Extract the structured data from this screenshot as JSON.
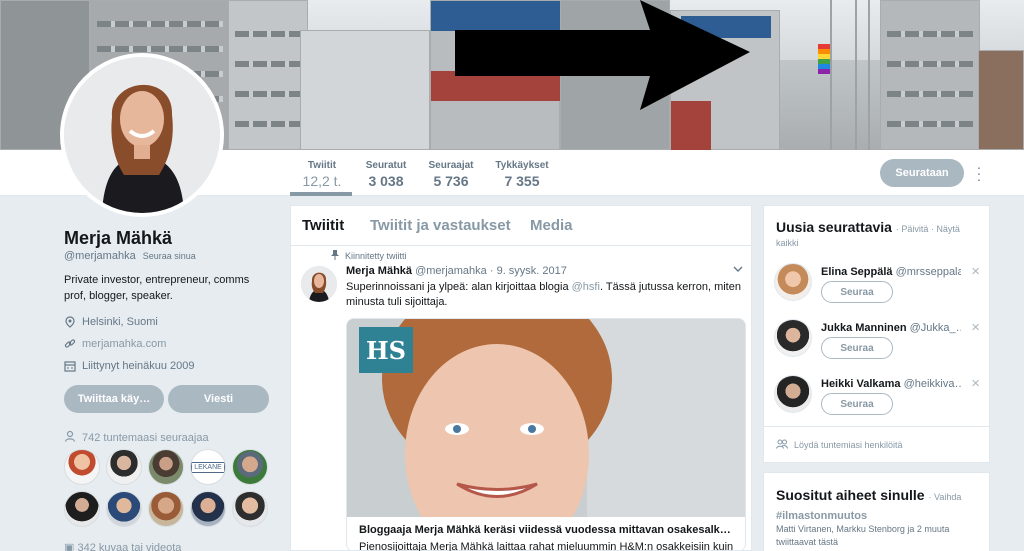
{
  "profile": {
    "name": "Merja Mähkä",
    "handle": "@merjamahka",
    "follows_you": "Seuraa sinua",
    "bio": "Private investor, entrepreneur, comms prof, blogger, speaker.",
    "location": "Helsinki, Suomi",
    "website": "merjamahka.com",
    "joined": "Liittynyt heinäkuu 2009",
    "tweet_to_button": "Twiittaa käy…",
    "message_button": "Viesti",
    "followers_you_know": "742 tuntemaasi seuraajaa",
    "photos_videos": "342 kuvaa tai videota"
  },
  "stats": [
    {
      "label": "Twiitit",
      "value": "12,2 t."
    },
    {
      "label": "Seuratut",
      "value": "3 038"
    },
    {
      "label": "Seuraajat",
      "value": "5 736"
    },
    {
      "label": "Tykkäykset",
      "value": "7 355"
    }
  ],
  "header": {
    "following_button": "Seurataan",
    "more_icon": "more-vertical-icon"
  },
  "timeline": {
    "tabs": [
      "Twiitit",
      "Twiitit ja vastaukset",
      "Media"
    ],
    "pinned_label": "Kiinnitetty twiitti",
    "tweet": {
      "author": "Merja Mähkä",
      "handle": "@merjamahka",
      "date": "· 9. syysk. 2017",
      "text_before": "Superinnoissani ja ylpeä: alan kirjoittaa blogia ",
      "mention": "@hsfi",
      "text_after": ". Tässä jutussa kerron, miten minusta tuli sijoittaja.",
      "card_logo": "HS",
      "card_title": "Bloggaaja Merja Mähkä keräsi viidessä vuodessa mittavan osakesalk…",
      "card_desc": "Pienosijoittaja Merja Mähkä laittaa rahat mieluummin H&M:n osakkeisiin kuin"
    }
  },
  "who_to_follow": {
    "title": "Uusia seurattavia",
    "refresh": "· Päivitä · Näytä",
    "show_all": "kaikki",
    "items": [
      {
        "name": "Elina Seppälä",
        "handle": "@mrsseppala",
        "button": "Seuraa"
      },
      {
        "name": "Jukka Manninen",
        "handle": "@Jukka_…",
        "button": "Seuraa"
      },
      {
        "name": "Heikki Valkama",
        "handle": "@heikkiva…",
        "button": "Seuraa"
      }
    ],
    "find_people": "Löydä tuntemiasi henkilöitä"
  },
  "trends": {
    "title": "Suositut aiheet sinulle",
    "change": "· Vaihda",
    "tag": "#ilmastonmuutos",
    "desc": "Matti Virtanen, Markku Stenborg ja 2 muuta twiittaavat tästä"
  },
  "colors": {
    "background": "#e6ecf0",
    "muted_button": "#aab8c2",
    "text_secondary": "#657786",
    "link": "#8899a6"
  }
}
